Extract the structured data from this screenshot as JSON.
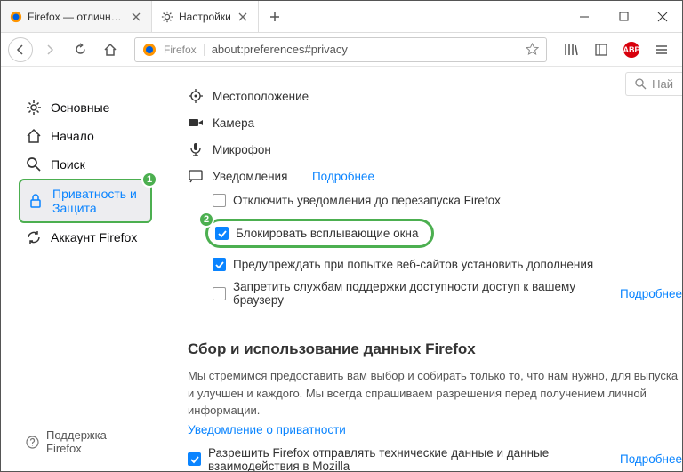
{
  "tabs": [
    {
      "title": "Firefox — отличный браузер д",
      "active": false
    },
    {
      "title": "Настройки",
      "active": true
    }
  ],
  "urlbar": {
    "prefix": "Firefox",
    "url": "about:preferences#privacy"
  },
  "search_placeholder": "Най",
  "sidebar": {
    "items": [
      {
        "label": "Основные"
      },
      {
        "label": "Начало"
      },
      {
        "label": "Поиск"
      },
      {
        "label": "Приватность и Защита"
      },
      {
        "label": "Аккаунт Firefox"
      }
    ],
    "support": "Поддержка Firefox"
  },
  "badges": {
    "sidebar": "1",
    "checkbox": "2"
  },
  "perms": {
    "location": "Местоположение",
    "camera": "Камера",
    "microphone": "Микрофон",
    "notifications": "Уведомления",
    "learn_more": "Подробнее",
    "disable_until_restart": "Отключить уведомления до перезапуска Firefox"
  },
  "checks": {
    "block_popups": "Блокировать всплывающие окна",
    "warn_addons": "Предупреждать при попытке веб-сайтов установить дополнения",
    "block_a11y": "Запретить службам поддержки доступности доступ к вашему браузеру"
  },
  "data_section": {
    "title": "Сбор и использование данных Firefox",
    "text": "Мы стремимся предоставить вам выбор и собирать только то, что нам нужно, для выпуска и улучшен и каждого. Мы всегда спрашиваем разрешения перед получением личной информации.",
    "privacy_link": "Уведомление о приватности",
    "allow_telemetry": "Разрешить Firefox отправлять технические данные и данные взаимодействия в Mozilla",
    "learn_more": "Подробнее"
  }
}
